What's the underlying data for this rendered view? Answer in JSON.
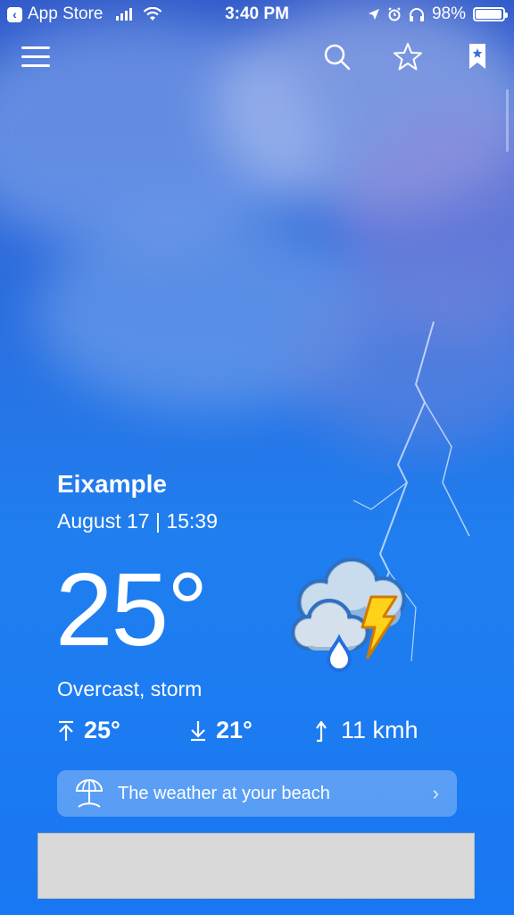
{
  "status_bar": {
    "back_app": "App Store",
    "time": "3:40 PM",
    "battery_percent": "98%",
    "battery_level": 0.98
  },
  "toolbar": {
    "menu_icon": "menu-icon",
    "search_icon": "search-icon",
    "favorite_icon": "star-icon",
    "bookmark_icon": "bookmark-icon"
  },
  "weather": {
    "location": "Eixample",
    "datetime": "August 17 | 15:39",
    "temperature": "25°",
    "condition": "Overcast, storm",
    "icon": "cloud-storm-rain-icon",
    "max_temp": "25°",
    "min_temp": "21°",
    "wind": "11 kmh"
  },
  "beach_banner": {
    "label": "The weather at your beach",
    "icon": "umbrella-beach-icon"
  },
  "colors": {
    "accent": "#1877f2",
    "sky_top": "#2f59c9",
    "banner_bg": "rgba(255,255,255,0.28)",
    "ad_placeholder": "#d9d9d9"
  }
}
